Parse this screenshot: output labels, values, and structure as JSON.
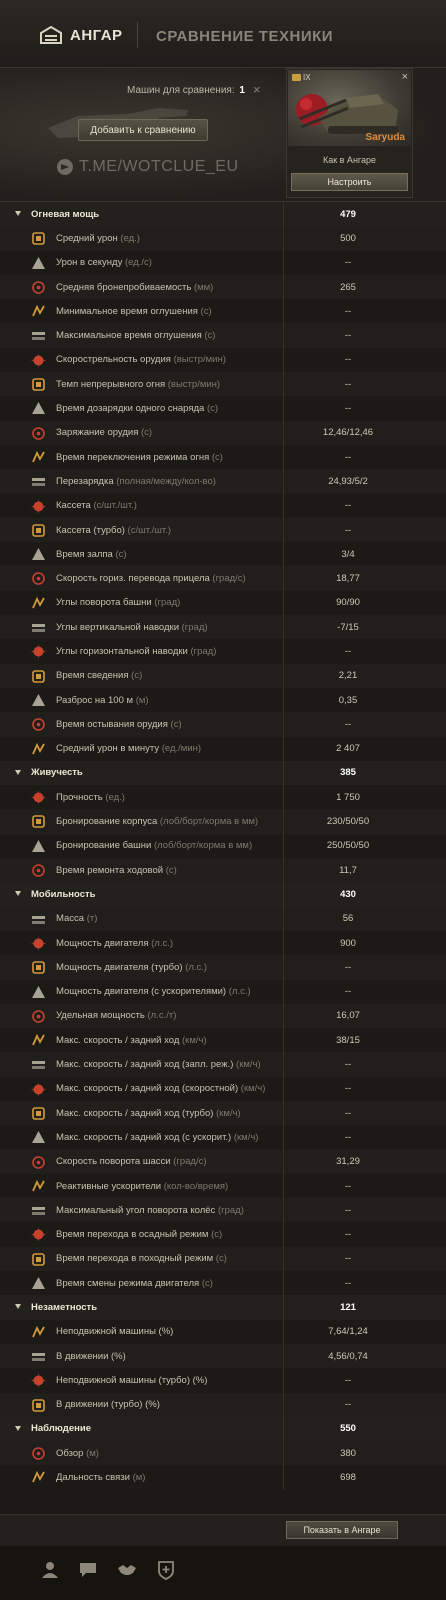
{
  "topbar": {
    "hangar_label": "АНГАР",
    "title": "СРАВНЕНИЕ ТЕХНИКИ"
  },
  "header": {
    "machines_label": "Машин для сравнения:",
    "machines_count": "1",
    "add_button": "Добавить к сравнению",
    "watermark": "T.ME/WOTCLUE_EU"
  },
  "vehicle": {
    "tier": "IX",
    "name": "Saryuda",
    "preset": "Как в Ангаре",
    "configure_button": "Настроить"
  },
  "rows": [
    {
      "type": "cat",
      "label": "Огневая мощь",
      "value": "479"
    },
    {
      "type": "stat",
      "icon": "damage-icon",
      "label": "Средний урон",
      "unit": "(ед.)",
      "value": "500"
    },
    {
      "type": "stat",
      "icon": "dps-icon",
      "label": "Урон в секунду",
      "unit": "(ед./с)",
      "value": "--"
    },
    {
      "type": "stat",
      "icon": "penetration-icon",
      "label": "Средняя бронепробиваемость",
      "unit": "(мм)",
      "value": "265"
    },
    {
      "type": "stat",
      "icon": "stun-min-icon",
      "label": "Минимальное время оглушения",
      "unit": "(с)",
      "value": "--"
    },
    {
      "type": "stat",
      "icon": "stun-max-icon",
      "label": "Максимальное время оглушения",
      "unit": "(с)",
      "value": "--"
    },
    {
      "type": "stat",
      "icon": "rate-of-fire-icon",
      "label": "Скорострельность орудия",
      "unit": "(выстр/мин)",
      "value": "--"
    },
    {
      "type": "stat",
      "icon": "continuous-fire-icon",
      "label": "Темп непрерывного огня",
      "unit": "(выстр/мин)",
      "value": "--"
    },
    {
      "type": "stat",
      "icon": "shell-reload-icon",
      "label": "Время дозарядки одного снаряда",
      "unit": "(с)",
      "value": "--"
    },
    {
      "type": "stat",
      "icon": "gun-loading-icon",
      "label": "Заряжание орудия",
      "unit": "(с)",
      "value": "12,46/12,46"
    },
    {
      "type": "stat",
      "icon": "fire-mode-icon",
      "label": "Время переключения режима огня",
      "unit": "(с)",
      "value": "--"
    },
    {
      "type": "stat",
      "icon": "reload-icon",
      "label": "Перезарядка",
      "unit": "(полная/между/кол-во)",
      "value": "24,93/5/2"
    },
    {
      "type": "stat",
      "icon": "clip-icon",
      "label": "Кассета",
      "unit": "(с/шт./шт.)",
      "value": "--"
    },
    {
      "type": "stat",
      "icon": "clip-turbo-icon",
      "label": "Кассета (турбо)",
      "unit": "(с/шт./шт.)",
      "value": "--"
    },
    {
      "type": "stat",
      "icon": "salvo-icon",
      "label": "Время залпа",
      "unit": "(с)",
      "value": "3/4"
    },
    {
      "type": "stat",
      "icon": "traverse-icon",
      "label": "Скорость гориз. перевода прицела",
      "unit": "(град/с)",
      "value": "18,77"
    },
    {
      "type": "stat",
      "icon": "turret-angle-icon",
      "label": "Углы поворота башни",
      "unit": "(град)",
      "value": "90/90"
    },
    {
      "type": "stat",
      "icon": "elevation-icon",
      "label": "Углы вертикальной наводки",
      "unit": "(град)",
      "value": "-7/15"
    },
    {
      "type": "stat",
      "icon": "horizontal-aim-icon",
      "label": "Углы горизонтальной наводки",
      "unit": "(град)",
      "value": "--"
    },
    {
      "type": "stat",
      "icon": "aim-time-icon",
      "label": "Время сведения",
      "unit": "(с)",
      "value": "2,21"
    },
    {
      "type": "stat",
      "icon": "dispersion-icon",
      "label": "Разброс на 100 м",
      "unit": "(м)",
      "value": "0,35"
    },
    {
      "type": "stat",
      "icon": "cooldown-icon",
      "label": "Время остывания орудия",
      "unit": "(с)",
      "value": "--"
    },
    {
      "type": "stat",
      "icon": "dpm-icon",
      "label": "Средний урон в минуту",
      "unit": "(ед./мин)",
      "value": "2 407"
    },
    {
      "type": "cat",
      "label": "Живучесть",
      "value": "385"
    },
    {
      "type": "stat",
      "icon": "hp-icon",
      "label": "Прочность",
      "unit": "(ед.)",
      "value": "1 750"
    },
    {
      "type": "stat",
      "icon": "hull-armor-icon",
      "label": "Бронирование корпуса",
      "unit": "(лоб/борт/корма в мм)",
      "value": "230/50/50"
    },
    {
      "type": "stat",
      "icon": "turret-armor-icon",
      "label": "Бронирование башни",
      "unit": "(лоб/борт/корма в мм)",
      "value": "250/50/50"
    },
    {
      "type": "stat",
      "icon": "repair-icon",
      "label": "Время ремонта ходовой",
      "unit": "(с)",
      "value": "11,7"
    },
    {
      "type": "cat",
      "label": "Мобильность",
      "value": "430"
    },
    {
      "type": "stat",
      "icon": "weight-icon",
      "label": "Масса",
      "unit": "(т)",
      "value": "56"
    },
    {
      "type": "stat",
      "icon": "engine-icon",
      "label": "Мощность двигателя",
      "unit": "(л.с.)",
      "value": "900"
    },
    {
      "type": "stat",
      "icon": "engine-turbo-icon",
      "label": "Мощность двигателя (турбо)",
      "unit": "(л.с.)",
      "value": "--"
    },
    {
      "type": "stat",
      "icon": "engine-boost-icon",
      "label": "Мощность двигателя (с ускорителями)",
      "unit": "(л.с.)",
      "value": "--"
    },
    {
      "type": "stat",
      "icon": "specific-power-icon",
      "label": "Удельная мощность",
      "unit": "(л.с./т)",
      "value": "16,07"
    },
    {
      "type": "stat",
      "icon": "speed-icon",
      "label": "Макс. скорость / задний ход",
      "unit": "(км/ч)",
      "value": "38/15"
    },
    {
      "type": "stat",
      "icon": "speed-siege-icon",
      "label": "Макс. скорость / задний ход (запл. реж.)",
      "unit": "(км/ч)",
      "value": "--"
    },
    {
      "type": "stat",
      "icon": "speed-fast-icon",
      "label": "Макс. скорость / задний ход (скоростной)",
      "unit": "(км/ч)",
      "value": "--"
    },
    {
      "type": "stat",
      "icon": "speed-turbo-icon",
      "label": "Макс. скорость / задний ход (турбо)",
      "unit": "(км/ч)",
      "value": "--"
    },
    {
      "type": "stat",
      "icon": "speed-boost-icon",
      "label": "Макс. скорость / задний ход (с ускорит.)",
      "unit": "(км/ч)",
      "value": "--"
    },
    {
      "type": "stat",
      "icon": "chassis-rotation-icon",
      "label": "Скорость поворота шасси",
      "unit": "(град/с)",
      "value": "31,29"
    },
    {
      "type": "stat",
      "icon": "rocket-boost-icon",
      "label": "Реактивные ускорители",
      "unit": "(кол-во/время)",
      "value": "--"
    },
    {
      "type": "stat",
      "icon": "wheel-angle-icon",
      "label": "Максимальный угол поворота колёс",
      "unit": "(град)",
      "value": "--"
    },
    {
      "type": "stat",
      "icon": "siege-mode-icon",
      "label": "Время перехода в осадный режим",
      "unit": " (с)",
      "value": "--"
    },
    {
      "type": "stat",
      "icon": "travel-mode-icon",
      "label": "Время перехода в походный режим",
      "unit": " (с)",
      "value": "--"
    },
    {
      "type": "stat",
      "icon": "engine-mode-icon",
      "label": "Время смены режима двигателя",
      "unit": "(с)",
      "value": "--"
    },
    {
      "type": "cat",
      "label": "Незаметность",
      "value": "121"
    },
    {
      "type": "stat",
      "icon": "camo-stationary-icon",
      "label": "Неподвижной машины (%)",
      "unit": "",
      "value": "7,64/1,24"
    },
    {
      "type": "stat",
      "icon": "camo-moving-icon",
      "label": "В движении (%)",
      "unit": "",
      "value": "4,56/0,74"
    },
    {
      "type": "stat",
      "icon": "camo-stationary-turbo-icon",
      "label": "Неподвижной машины (турбо) (%)",
      "unit": "",
      "value": "--"
    },
    {
      "type": "stat",
      "icon": "camo-moving-turbo-icon",
      "label": "В движении (турбо) (%)",
      "unit": "",
      "value": "--"
    },
    {
      "type": "cat",
      "label": "Наблюдение",
      "value": "550"
    },
    {
      "type": "stat",
      "icon": "view-range-icon",
      "label": "Обзор",
      "unit": "(м)",
      "value": "380"
    },
    {
      "type": "stat",
      "icon": "radio-range-icon",
      "label": "Дальность связи",
      "unit": "(м)",
      "value": "698"
    }
  ],
  "footer": {
    "show_in_hangar": "Показать в Ангаре"
  },
  "bottombar": {
    "icons": [
      "profile-icon",
      "chat-icon",
      "handshake-icon",
      "add-shield-icon"
    ]
  },
  "colors": {
    "background": "#1b1a17",
    "vehicle_name": "#e08a3c",
    "icon_red": "#c8412e",
    "icon_gold": "#d49a3a",
    "icon_grey": "#a9a394"
  }
}
